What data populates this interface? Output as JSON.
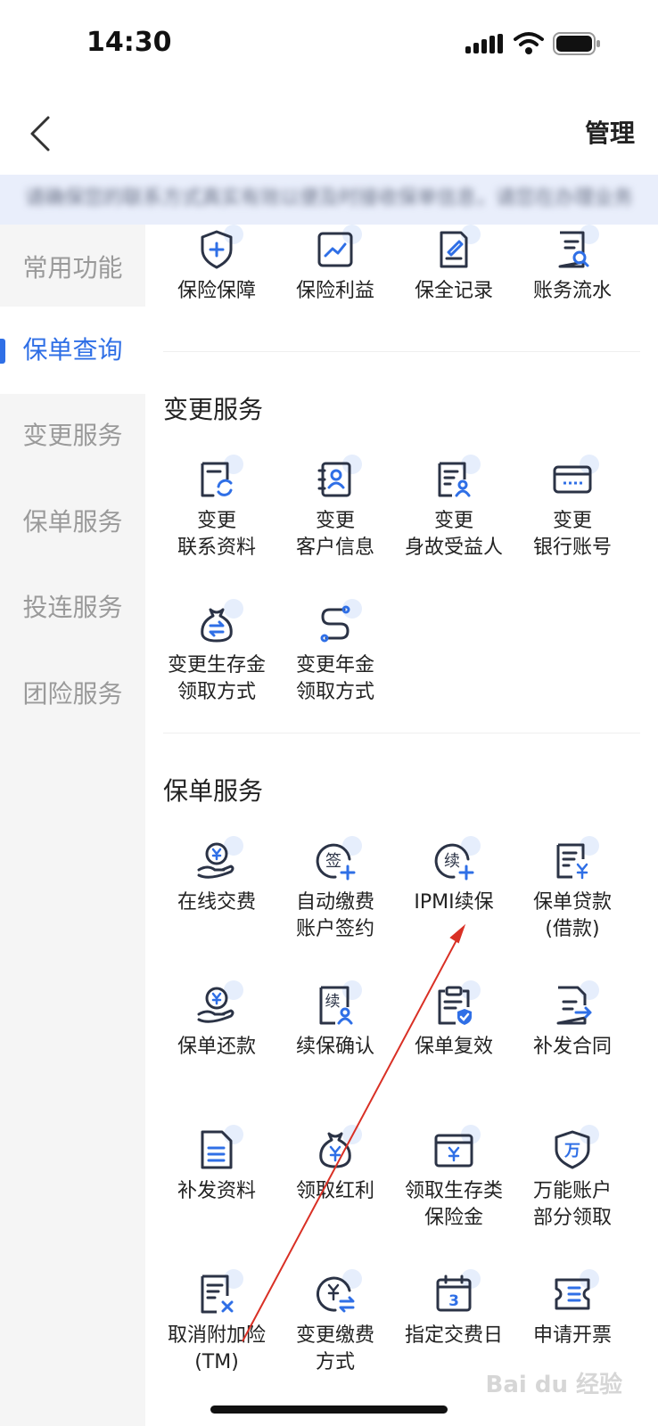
{
  "status_bar": {
    "time": "14:30"
  },
  "header": {
    "manage_label": "管理"
  },
  "notice": {
    "text": "请确保您的联系方式真实有效以便及时接收保单信息，请您在办理业务时仔细核对信息以确保准确"
  },
  "sidebar": {
    "items": [
      {
        "label": "常用功能",
        "active": false
      },
      {
        "label": "保单查询",
        "active": true
      },
      {
        "label": "变更服务",
        "active": false
      },
      {
        "label": "保单服务",
        "active": false
      },
      {
        "label": "投连服务",
        "active": false
      },
      {
        "label": "团险服务",
        "active": false
      }
    ]
  },
  "query_items": [
    {
      "label": "保险保障",
      "icon": "shield-plus-icon"
    },
    {
      "label": "保险利益",
      "icon": "trend-chart-icon"
    },
    {
      "label": "保全记录",
      "icon": "doc-edit-icon"
    },
    {
      "label": "账务流水",
      "icon": "doc-search-icon"
    }
  ],
  "change_service": {
    "title": "变更服务",
    "items": [
      {
        "line1": "变更",
        "line2": "联系资料",
        "icon": "doc-refresh-icon"
      },
      {
        "line1": "变更",
        "line2": "客户信息",
        "icon": "contact-card-icon"
      },
      {
        "line1": "变更",
        "line2": "身故受益人",
        "icon": "doc-person-icon"
      },
      {
        "line1": "变更",
        "line2": "银行账号",
        "icon": "bank-card-icon"
      },
      {
        "line1": "变更生存金",
        "line2": "领取方式",
        "icon": "money-bag-exchange-icon"
      },
      {
        "line1": "变更年金",
        "line2": "领取方式",
        "icon": "route-icon"
      }
    ]
  },
  "policy_service": {
    "title": "保单服务",
    "items": [
      {
        "line1": "在线交费",
        "line2": "",
        "icon": "hand-coin-icon"
      },
      {
        "line1": "自动缴费",
        "line2": "账户签约",
        "icon": "sign-plus-icon"
      },
      {
        "line1": "IPMI续保",
        "line2": "",
        "icon": "renew-plus-icon"
      },
      {
        "line1": "保单贷款",
        "line2": "(借款)",
        "icon": "doc-yen-icon"
      },
      {
        "line1": "保单还款",
        "line2": "",
        "icon": "hand-coin-icon"
      },
      {
        "line1": "续保确认",
        "line2": "",
        "icon": "renew-confirm-icon"
      },
      {
        "line1": "保单复效",
        "line2": "",
        "icon": "clipboard-check-icon"
      },
      {
        "line1": "补发合同",
        "line2": "",
        "icon": "doc-send-icon"
      },
      {
        "line1": "补发资料",
        "line2": "",
        "icon": "doc-lines-icon"
      },
      {
        "line1": "领取红利",
        "line2": "",
        "icon": "money-bag-icon"
      },
      {
        "line1": "领取生存类",
        "line2": "保险金",
        "icon": "wallet-yen-icon"
      },
      {
        "line1": "万能账户",
        "line2": "部分领取",
        "icon": "universal-shield-icon"
      },
      {
        "line1": "取消附加险",
        "line2": "(TM)",
        "icon": "doc-cancel-icon"
      },
      {
        "line1": "变更缴费",
        "line2": "方式",
        "icon": "yen-exchange-icon"
      },
      {
        "line1": "指定交费日",
        "line2": "",
        "icon": "calendar-icon"
      },
      {
        "line1": "申请开票",
        "line2": "",
        "icon": "ticket-icon"
      }
    ]
  },
  "icon_labels": {
    "sign": "签",
    "renew": "续",
    "universal": "万",
    "calendar_day": "3"
  },
  "watermark": "Bai du 经验",
  "colors": {
    "accent": "#2f6fe6",
    "icon_stroke": "#2b3346",
    "icon_bubble": "#e6eefc",
    "annotation_arrow": "#d93025"
  }
}
